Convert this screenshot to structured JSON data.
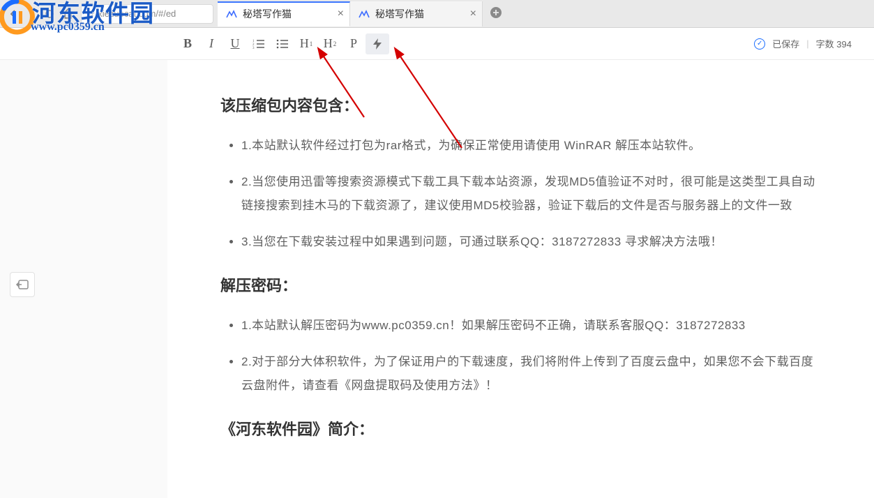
{
  "browser": {
    "url": "xiezuocat.com/#/ed",
    "tabs": [
      {
        "title": "秘塔写作猫"
      },
      {
        "title": "秘塔写作猫"
      }
    ]
  },
  "toolbar": {
    "bold": "B",
    "italic": "I",
    "underline": "U",
    "h1": "H",
    "h2": "H",
    "p": "P"
  },
  "status": {
    "saved_label": "已保存",
    "count_label": "字数",
    "count_value": "394"
  },
  "document": {
    "section1_title": "该压缩包内容包含：",
    "section1_items": [
      "1.本站默认软件经过打包为rar格式，为确保正常使用请使用 WinRAR 解压本站软件。",
      "2.当您使用迅雷等搜索资源模式下载工具下载本站资源，发现MD5值验证不对时，很可能是这类型工具自动链接搜索到挂木马的下载资源了，建议使用MD5校验器，验证下载后的文件是否与服务器上的文件一致",
      "3.当您在下载安装过程中如果遇到问题，可通过联系QQ：3187272833 寻求解决方法哦！"
    ],
    "section2_title": "解压密码：",
    "section2_items": [
      "1.本站默认解压密码为www.pc0359.cn！如果解压密码不正确，请联系客服QQ：3187272833",
      "2.对于部分大体积软件，为了保证用户的下载速度，我们将附件上传到了百度云盘中，如果您不会下载百度云盘附件，请查看《网盘提取码及使用方法》！"
    ],
    "section3_title": "《河东软件园》简介："
  },
  "watermark": {
    "cn": "河东软件园",
    "en": "www.pc0359.cn"
  }
}
